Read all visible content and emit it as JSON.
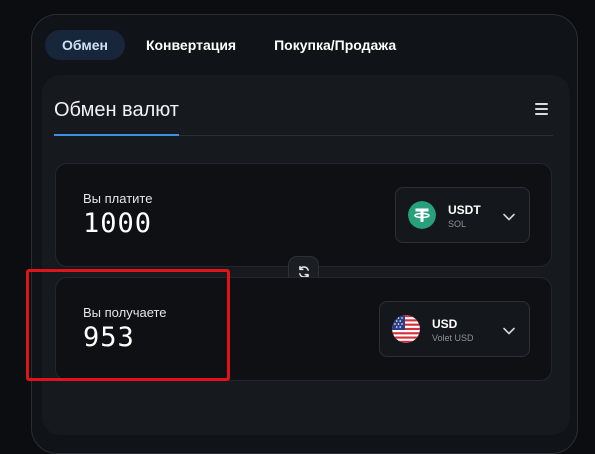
{
  "tabs": [
    {
      "label": "Обмен",
      "active": true
    },
    {
      "label": "Конвертация",
      "active": false
    },
    {
      "label": "Покупка/Продажа",
      "active": false
    }
  ],
  "card": {
    "title": "Обмен валют",
    "menu_icon": "hamburger-menu-icon"
  },
  "pay": {
    "label": "Вы платите",
    "amount": "1000",
    "currency": {
      "code": "USDT",
      "network": "SOL",
      "icon": "tether-icon",
      "color": "#27a17c"
    }
  },
  "receive": {
    "label": "Вы получаете",
    "amount": "953",
    "currency": {
      "code": "USD",
      "network": "Volet USD",
      "icon": "us-flag-icon"
    }
  },
  "swap_icon": "swap-arrows-icon",
  "colors": {
    "accent": "#3d8fe0",
    "highlight": "#e0131b",
    "active_tab_bg": "#17263a"
  }
}
